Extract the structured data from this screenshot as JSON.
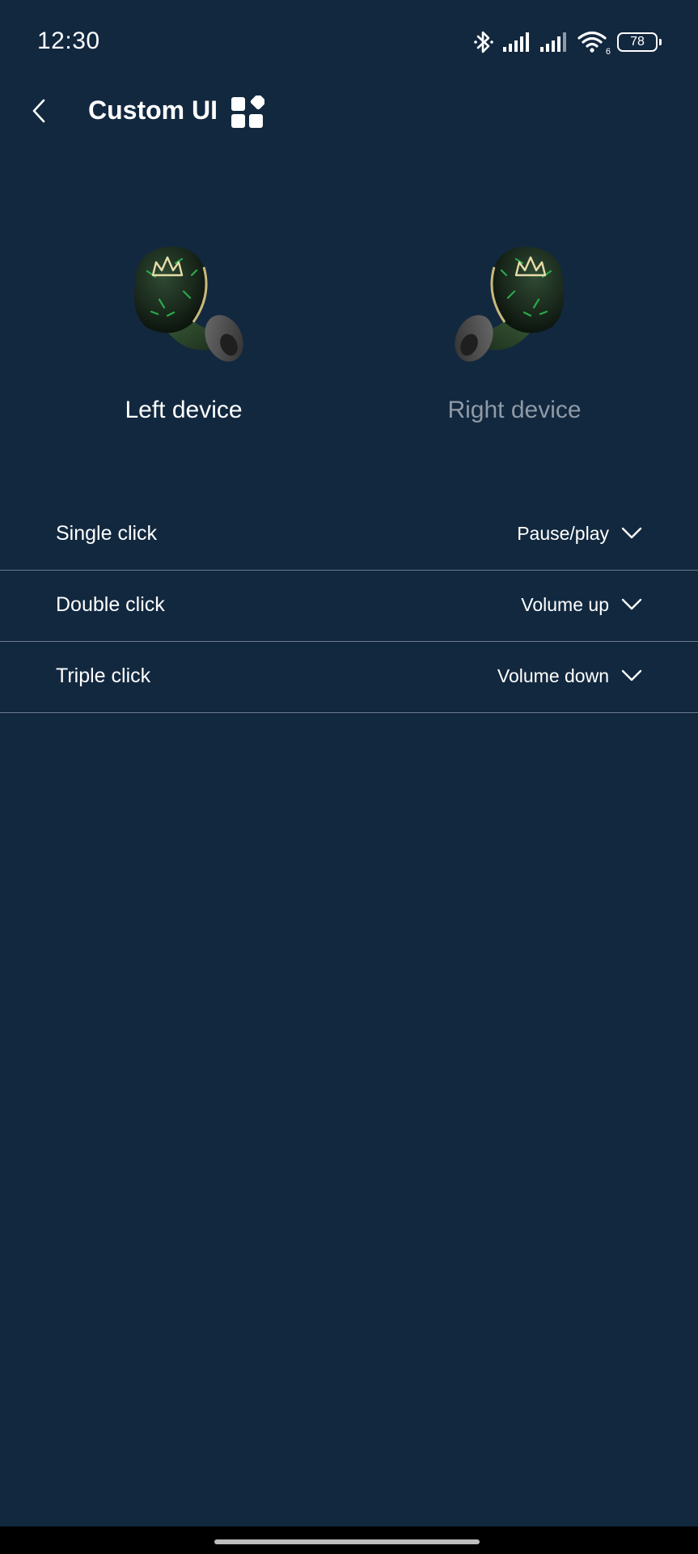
{
  "status_bar": {
    "time": "12:30",
    "battery_level": "78",
    "wifi_label": "6",
    "icons": [
      "bluetooth-icon",
      "signal-icon",
      "signal-icon",
      "wifi-icon",
      "battery-icon"
    ]
  },
  "header": {
    "title": "Custom UI",
    "back_icon": "chevron-left-icon",
    "widgets_icon": "widgets-icon"
  },
  "devices": [
    {
      "label": "Left device",
      "selected": true
    },
    {
      "label": "Right device",
      "selected": false
    }
  ],
  "settings": [
    {
      "label": "Single click",
      "value": "Pause/play"
    },
    {
      "label": "Double click",
      "value": "Volume up"
    },
    {
      "label": "Triple click",
      "value": "Volume down"
    }
  ],
  "colors": {
    "background": "#12283f",
    "text": "#ffffff",
    "inactive_text": "#8f9aa6",
    "divider": "#6b7a8b",
    "earbud_green": "#1e4a2a",
    "earbud_accent": "#c9b97a"
  }
}
